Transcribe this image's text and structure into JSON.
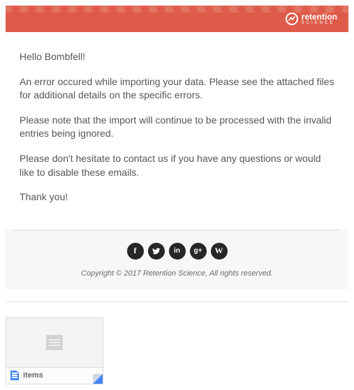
{
  "brand": {
    "name_top": "retention",
    "name_bottom": "SCIENCE"
  },
  "email": {
    "greeting": "Hello Bombfell!",
    "p1": "An error occured while importing your data. Please see the attached files for additional details on the specific errors.",
    "p2": "Please note that the import will continue to be processed with the invalid entries being ignored.",
    "p3": "Please don't hesitate to contact us if you have any questions or would like to disable these emails.",
    "thanks": "Thank you!"
  },
  "social": {
    "facebook": "f",
    "twitter": "t",
    "linkedin": "in",
    "googleplus": "g+",
    "wordpress": "W"
  },
  "footer": {
    "copyright": "Copyright © 2017 Retention Science, All rights reserved."
  },
  "attachment": {
    "filename": "items"
  }
}
